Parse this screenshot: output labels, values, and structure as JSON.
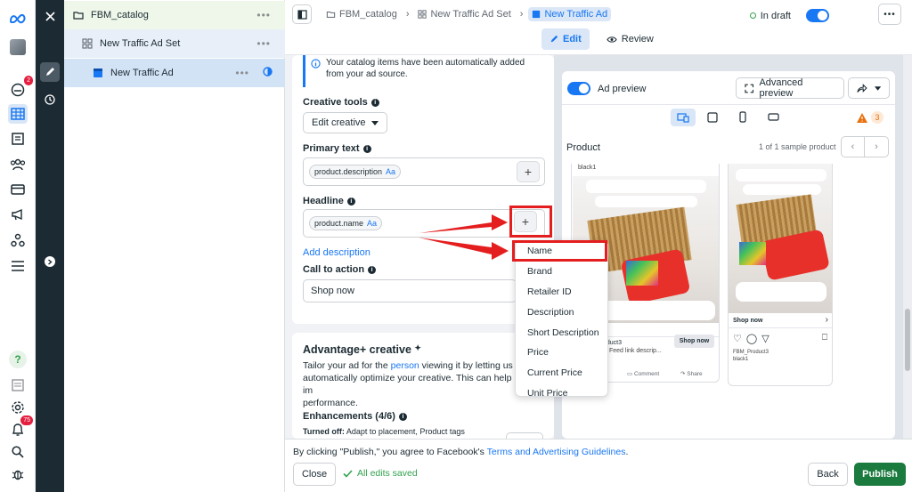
{
  "rail": {
    "badges": {
      "notifications": "2",
      "alerts": "75"
    },
    "help": "?"
  },
  "tree": {
    "campaign": "FBM_catalog",
    "adset": "New Traffic Ad Set",
    "ad": "New Traffic Ad",
    "dots": "•••"
  },
  "topbar": {
    "breadcrumbs": [
      "FBM_catalog",
      "New Traffic Ad Set",
      "New Traffic Ad"
    ],
    "tabs": {
      "edit": "Edit",
      "review": "Review"
    },
    "status": "In draft",
    "more": "•••"
  },
  "editor": {
    "notice": "Your catalog items have been automatically added from your ad source.",
    "creative_tools": {
      "label": "Creative tools",
      "button": "Edit creative"
    },
    "primary_text": {
      "label": "Primary text",
      "chip": "product.description",
      "chip_suffix": "Aa"
    },
    "headline": {
      "label": "Headline",
      "chip": "product.name",
      "chip_suffix": "Aa"
    },
    "add_description": "Add description",
    "cta": {
      "label": "Call to action",
      "value": "Shop now"
    },
    "advantage": {
      "title": "Advantage+ creative",
      "body_1": "Tailor your ad for the ",
      "body_link": "person",
      "body_2": " viewing it by letting us automatically optimize your creative. This can help im",
      "body_3": "performance.",
      "enhancements": "Enhancements (4/6)",
      "turned_off": "Turned off:",
      "turned_off_items": "Adapt to placement, Product tags"
    }
  },
  "menu": {
    "items": [
      "Name",
      "Brand",
      "Retailer ID",
      "Description",
      "Short Description",
      "Price",
      "Current Price",
      "Unit Price"
    ]
  },
  "preview": {
    "toggle_label": "Ad preview",
    "advanced": "Advanced preview",
    "warning_count": "3",
    "product_label": "Product",
    "sample": "1 of 1 sample product",
    "phone1": {
      "variant": "black1",
      "shop_now": "Shop now",
      "product": "oduct3",
      "feed_link": "Feed link descrip...",
      "comment": "Comment",
      "share": "Share"
    },
    "phone2": {
      "shop_now": "Shop now",
      "product": "FBM_Product3",
      "variant": "black1"
    }
  },
  "footer": {
    "terms_prefix": "By clicking \"Publish,\" you agree to Facebook's ",
    "terms_link": "Terms and Advertising Guidelines",
    "terms_suffix": ".",
    "close": "Close",
    "saved": "All edits saved",
    "back": "Back",
    "publish": "Publish"
  },
  "colors": {
    "accent": "#1877f2",
    "publish": "#1b7a3e",
    "highlight": "#e41e1e",
    "dark_strip": "#1c2b33"
  }
}
